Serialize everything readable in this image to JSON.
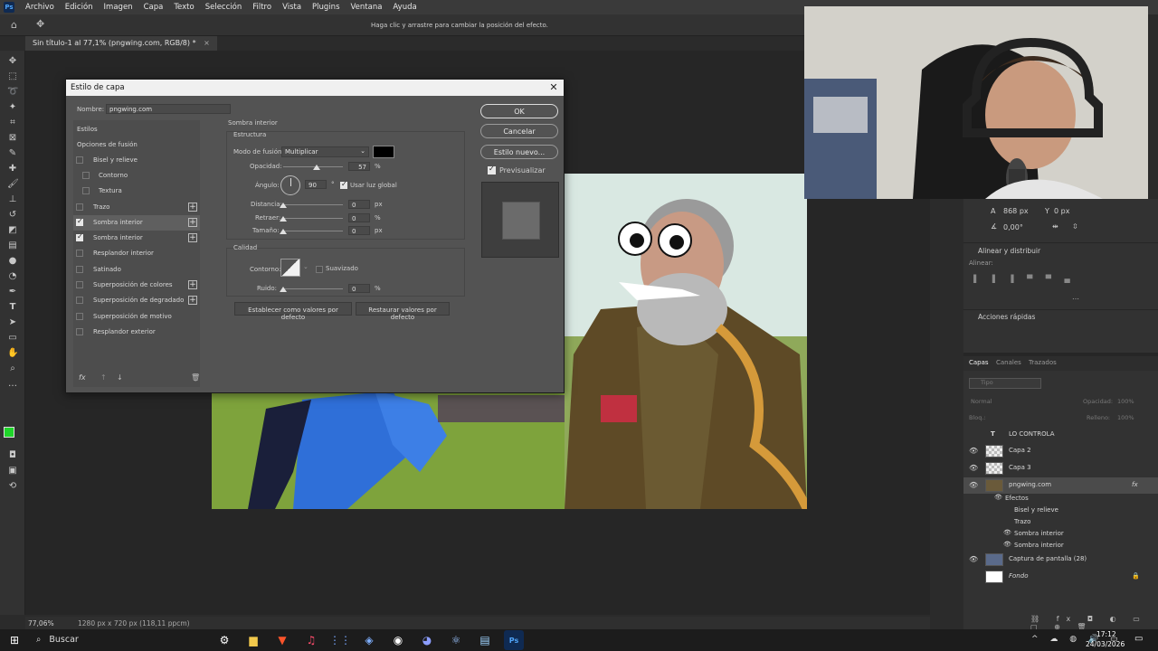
{
  "menubar": {
    "items": [
      "Archivo",
      "Edición",
      "Imagen",
      "Capa",
      "Texto",
      "Selección",
      "Filtro",
      "Vista",
      "Plugins",
      "Ventana",
      "Ayuda"
    ]
  },
  "optbar": {
    "hint": "Haga clic y arrastre para cambiar la posición del efecto."
  },
  "document": {
    "tab": "Sin título-1 al 77,1% (pngwing.com, RGB/8) *"
  },
  "status": {
    "zoom": "77,06%",
    "size": "1280 px x 720 px (118,11 ppcm)"
  },
  "dialog": {
    "title": "Estilo de capa",
    "name_label": "Nombre:",
    "name_value": "pngwing.com",
    "section_title": "Sombra interior",
    "estructura": "Estructura",
    "blend_label": "Modo de fusión:",
    "blend_value": "Multiplicar",
    "opacity_label": "Opacidad:",
    "opacity_value": "57",
    "angle_label": "Ángulo:",
    "angle_value": "90",
    "global_light": "Usar luz global",
    "distance_label": "Distancia:",
    "distance_value": "0",
    "choke_label": "Retraer:",
    "choke_value": "0",
    "size_label": "Tamaño:",
    "size_value": "0",
    "unit_px": "px",
    "unit_pct": "%",
    "degree": "°",
    "calidad": "Calidad",
    "contour_label": "Contorno:",
    "antialias": "Suavizado",
    "noise_label": "Ruido:",
    "noise_value": "0",
    "make_default": "Establecer como valores por defecto",
    "reset_default": "Restaurar valores por defecto",
    "ok": "OK",
    "cancel": "Cancelar",
    "new_style": "Estilo nuevo...",
    "preview": "Previsualizar",
    "styles": [
      {
        "label": "Estilos",
        "type": "header"
      },
      {
        "label": "Opciones de fusión",
        "type": "header"
      },
      {
        "label": "Bisel y relieve",
        "type": "check",
        "checked": false
      },
      {
        "label": "Contorno",
        "type": "subcheck",
        "checked": false
      },
      {
        "label": "Textura",
        "type": "subcheck",
        "checked": false
      },
      {
        "label": "Trazo",
        "type": "check",
        "checked": false,
        "plus": true
      },
      {
        "label": "Sombra interior",
        "type": "check",
        "checked": true,
        "plus": true
      },
      {
        "label": "Sombra interior",
        "type": "check",
        "checked": true,
        "plus": true
      },
      {
        "label": "Resplandor interior",
        "type": "check",
        "checked": false
      },
      {
        "label": "Satinado",
        "type": "check",
        "checked": false
      },
      {
        "label": "Superposición de colores",
        "type": "check",
        "checked": false,
        "plus": true
      },
      {
        "label": "Superposición de degradado",
        "type": "check",
        "checked": false,
        "plus": true
      },
      {
        "label": "Superposición de motivo",
        "type": "check",
        "checked": false
      },
      {
        "label": "Resplandor exterior",
        "type": "check",
        "checked": false
      }
    ],
    "footer_icons": [
      "fx",
      "↑",
      "↓",
      "🗑"
    ]
  },
  "properties": {
    "x_label": "A",
    "x_value": "868 px",
    "y_label": "Y",
    "y_value": "0 px",
    "angle_value": "0,00°",
    "align_title": "Alinear y distribuir",
    "align_sub": "Alinear:",
    "quick_title": "Acciones rápidas"
  },
  "layers_panel": {
    "tabs": [
      "Capas",
      "Canales",
      "Trazados"
    ],
    "search": "Tipo",
    "blend": "Normal",
    "opacity_label": "Opacidad:",
    "opacity_value": "100%",
    "lock_label": "Bloq.:",
    "fill_label": "Relleno:",
    "fill_value": "100%",
    "layers": [
      {
        "name": "LO CONTROLA",
        "kind": "text"
      },
      {
        "name": "Capa 2",
        "kind": "pixel"
      },
      {
        "name": "Capa 3",
        "kind": "pixel"
      },
      {
        "name": "pngwing.com",
        "kind": "pixel",
        "fx": "fx"
      },
      {
        "name": "Efectos",
        "kind": "effect"
      },
      {
        "name": "Bisel y relieve",
        "kind": "effect"
      },
      {
        "name": "Trazo",
        "kind": "effect"
      },
      {
        "name": "Sombra interior",
        "kind": "effect"
      },
      {
        "name": "Sombra interior",
        "kind": "effect"
      },
      {
        "name": "Captura de pantalla (28)",
        "kind": "pixel"
      },
      {
        "name": "Fondo",
        "kind": "bg"
      }
    ]
  },
  "taskbar": {
    "search": "Buscar",
    "time": "17:12",
    "date": "24/03/2026"
  },
  "colors": {
    "accent": "#31a8ff",
    "fg_swatch": "#1fd52a",
    "bg_swatch": "#7a2ecf"
  }
}
